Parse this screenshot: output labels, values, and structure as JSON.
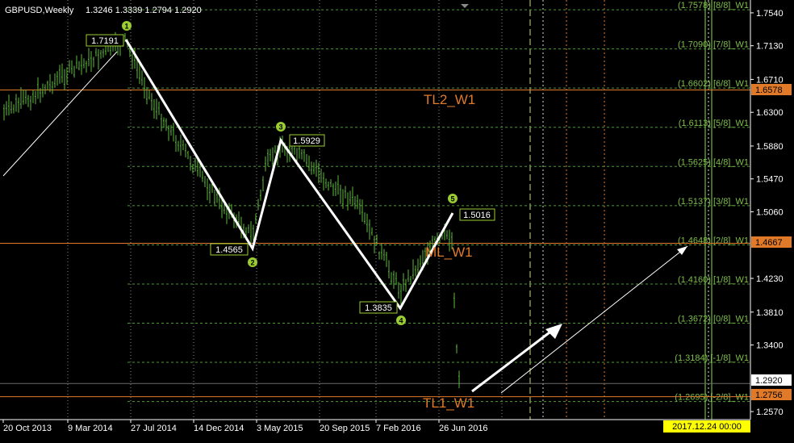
{
  "header": {
    "symbol_timeframe": "GBPUSD,Weekly",
    "ohlc": "1.3246 1.3339 1.2794 1.2920"
  },
  "price_axis": {
    "ticks": [
      "1.7540",
      "1.7130",
      "1.6710",
      "1.6300",
      "1.5880",
      "1.5470",
      "1.5060",
      "1.4230",
      "1.3810",
      "1.3400",
      "1.2570"
    ],
    "min": 1.247,
    "max": 1.77
  },
  "time_axis": {
    "ticks": [
      "20 Oct 2013",
      "9 Mar 2014",
      "27 Jul 2014",
      "14 Dec 2014",
      "3 May 2015",
      "20 Sep 2015",
      "7 Feb 2016",
      "26 Jun 2016"
    ],
    "cursor_date": "2017.12.24 00:00"
  },
  "price_labels": {
    "current": "1.2920",
    "tl2": "1.6578",
    "ml": "1.4667",
    "tl1": "1.2756"
  },
  "murrey_levels": [
    {
      "value": 1.7578,
      "label": "(1.7578) [8/8]_W1"
    },
    {
      "value": 1.709,
      "label": "(1.7090) [7/8]_W1"
    },
    {
      "value": 1.6602,
      "label": "(1.6602) [6/8]_W1"
    },
    {
      "value": 1.6113,
      "label": "(1.6113) [5/8]_W1"
    },
    {
      "value": 1.5625,
      "label": "(1.5625) [4/8]_W1"
    },
    {
      "value": 1.5137,
      "label": "(1.5137) [3/8]_W1"
    },
    {
      "value": 1.4648,
      "label": "(1.4648) [2/8]_W1"
    },
    {
      "value": 1.416,
      "label": "(1.4160) [1/8]_W1"
    },
    {
      "value": 1.3672,
      "label": "(1.3672) [0/8]_W1"
    },
    {
      "value": 1.3184,
      "label": "(1.3184) [-1/8]_W1"
    },
    {
      "value": 1.2695,
      "label": "(1.2695) [-2/8]_W1"
    }
  ],
  "horizontal_lines": [
    {
      "name": "TL2_W1",
      "value": 1.6578,
      "color": "#e07a28"
    },
    {
      "name": "ML_W1",
      "value": 1.4667,
      "color": "#e07a28"
    },
    {
      "name": "TL1_W1",
      "value": 1.2756,
      "color": "#e07a28"
    },
    {
      "name": "bid",
      "value": 1.292,
      "color": "#6b6b6b"
    }
  ],
  "line_labels": {
    "tl2": "TL2_W1",
    "ml": "ML_W1",
    "tl1": "TL1_W1"
  },
  "waves": [
    {
      "num": "1",
      "value": "1.7191"
    },
    {
      "num": "2",
      "value": "1.4565"
    },
    {
      "num": "3",
      "value": "1.5929"
    },
    {
      "num": "4",
      "value": "1.3835"
    },
    {
      "num": "5",
      "value": "1.5016"
    }
  ],
  "colors": {
    "background": "#000000",
    "candle": "#5dba3a",
    "wave_line": "#ffffff",
    "wave_marker": "#9acd32",
    "level_line": "#4a9a35",
    "level_text": "#7fbf4a",
    "orange": "#e07a28",
    "axis_text": "#ffffff",
    "cursor_bg": "#ffff00"
  }
}
